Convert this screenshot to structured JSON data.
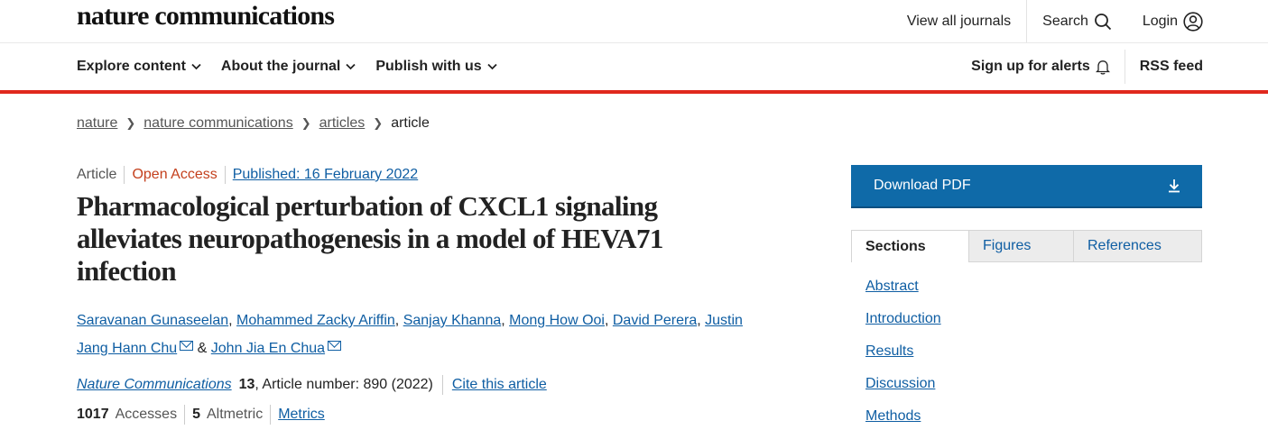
{
  "header": {
    "logo": "nature communications",
    "view_all": "View all journals",
    "search": "Search",
    "login": "Login"
  },
  "nav": {
    "explore": "Explore content",
    "about": "About the journal",
    "publish": "Publish with us",
    "alerts": "Sign up for alerts",
    "rss": "RSS feed"
  },
  "breadcrumb": [
    "nature",
    "nature communications",
    "articles",
    "article"
  ],
  "article": {
    "type": "Article",
    "open_access": "Open Access",
    "published": "Published: 16 February 2022",
    "title": "Pharmacological perturbation of CXCL1 signaling alleviates neuropathogenesis in a model of HEVA71 infection",
    "authors": [
      "Saravanan Gunaseelan",
      "Mohammed Zacky Ariffin",
      "Sanjay Khanna",
      "Mong How Ooi",
      "David Perera",
      "Justin Jang Hann Chu",
      "John Jia En Chua"
    ],
    "sep_comma": ",",
    "sep_amp": "&",
    "journal": "Nature Communications",
    "volume": "13",
    "article_number": ", Article number: 890 (2022)",
    "cite": "Cite this article",
    "accesses_count": "1017",
    "accesses_label": "Accesses",
    "altmetric_count": "5",
    "altmetric_label": "Altmetric",
    "metrics": "Metrics"
  },
  "sidebar": {
    "download": "Download PDF",
    "tabs": [
      "Sections",
      "Figures",
      "References"
    ],
    "sections": [
      "Abstract",
      "Introduction",
      "Results",
      "Discussion",
      "Methods"
    ]
  },
  "colors": {
    "accent_red": "#e0281d",
    "link_blue": "#0f5ea3",
    "download_bg": "#0f6aa8",
    "open_access": "#c4401d"
  },
  "icons": [
    "search-icon",
    "user-icon",
    "chevron-down-icon",
    "bell-icon",
    "download-icon",
    "mail-icon",
    "chevron-right-icon"
  ]
}
